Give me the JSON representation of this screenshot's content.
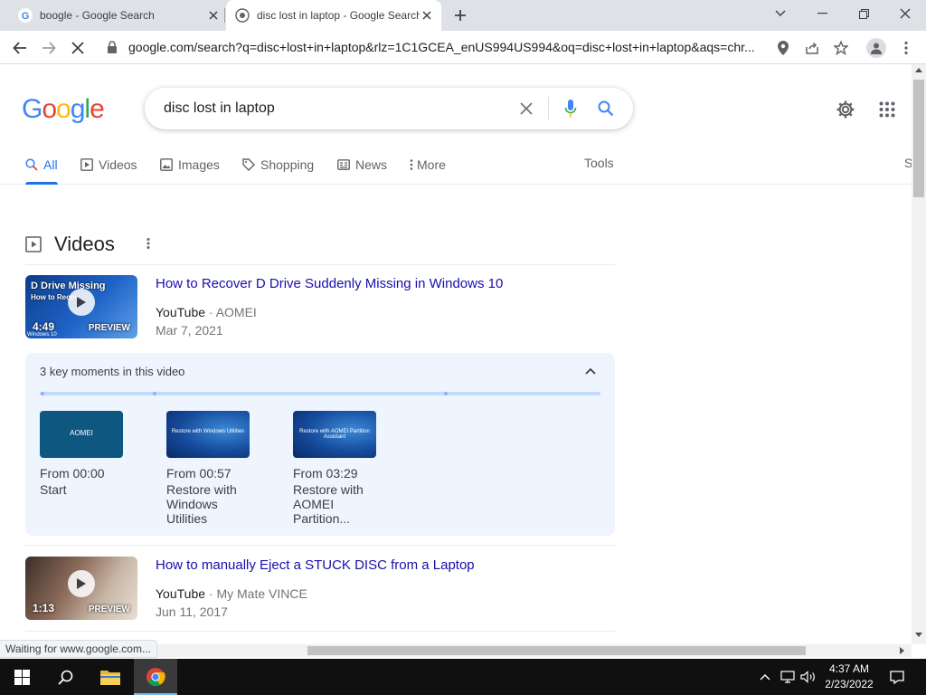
{
  "browser": {
    "tabs": [
      {
        "title": "boogle - Google Search",
        "active": false
      },
      {
        "title": "disc lost in laptop - Google Search",
        "active": true
      }
    ],
    "url": "google.com/search?q=disc+lost+in+laptop&rlz=1C1GCEA_enUS994US994&oq=disc+lost+in+laptop&aqs=chr...",
    "status_text": "Waiting for www.google.com..."
  },
  "google": {
    "logo": [
      "G",
      "o",
      "o",
      "g",
      "l",
      "e"
    ],
    "logo_colors": [
      "#4285f4",
      "#ea4335",
      "#fbbc05",
      "#4285f4",
      "#34a853",
      "#ea4335"
    ],
    "query": "disc lost in laptop",
    "tabs": [
      {
        "label": "All",
        "icon": "search-icon",
        "active": true
      },
      {
        "label": "Videos",
        "icon": "play-icon",
        "active": false
      },
      {
        "label": "Images",
        "icon": "image-icon",
        "active": false
      },
      {
        "label": "Shopping",
        "icon": "tag-icon",
        "active": false
      },
      {
        "label": "News",
        "icon": "news-icon",
        "active": false
      },
      {
        "label": "More",
        "icon": "dots-vertical-icon",
        "active": false
      }
    ],
    "tools_label": "Tools",
    "cutoff_label": "S"
  },
  "videos": {
    "section_title": "Videos",
    "items": [
      {
        "title": "How to Recover D Drive Suddenly Missing in Windows 10",
        "source": "YouTube",
        "channel": "AOMEI",
        "date": "Mar 7, 2021",
        "duration": "4:49",
        "preview": "PREVIEW",
        "thumb_text": "D Drive Missing",
        "thumb_subtext": "How to Recov",
        "thumb_corner": "Windows 10"
      },
      {
        "title": "How to manually Eject a STUCK DISC from a Laptop",
        "source": "YouTube",
        "channel": "My Mate VINCE",
        "date": "Jun 11, 2017",
        "duration": "1:13",
        "preview": "PREVIEW"
      }
    ],
    "key_moments": {
      "header": "3 key moments in this video",
      "moments": [
        {
          "time": "From 00:00",
          "label": "Start",
          "thumb_text": "AOMEI"
        },
        {
          "time": "From 00:57",
          "label": "Restore with Windows Utilities",
          "thumb_text": "Restore with Windows Utilities"
        },
        {
          "time": "From 03:29",
          "label": "Restore with AOMEI Partition...",
          "thumb_text": "Restore with AOMEI Partition Assistant"
        }
      ]
    }
  },
  "taskbar": {
    "time": "4:37 AM",
    "date": "2/23/2022"
  },
  "colors": {
    "accent": "#1a73e8",
    "link": "#1a0dab",
    "key_moments_bg": "#eef5ff"
  }
}
